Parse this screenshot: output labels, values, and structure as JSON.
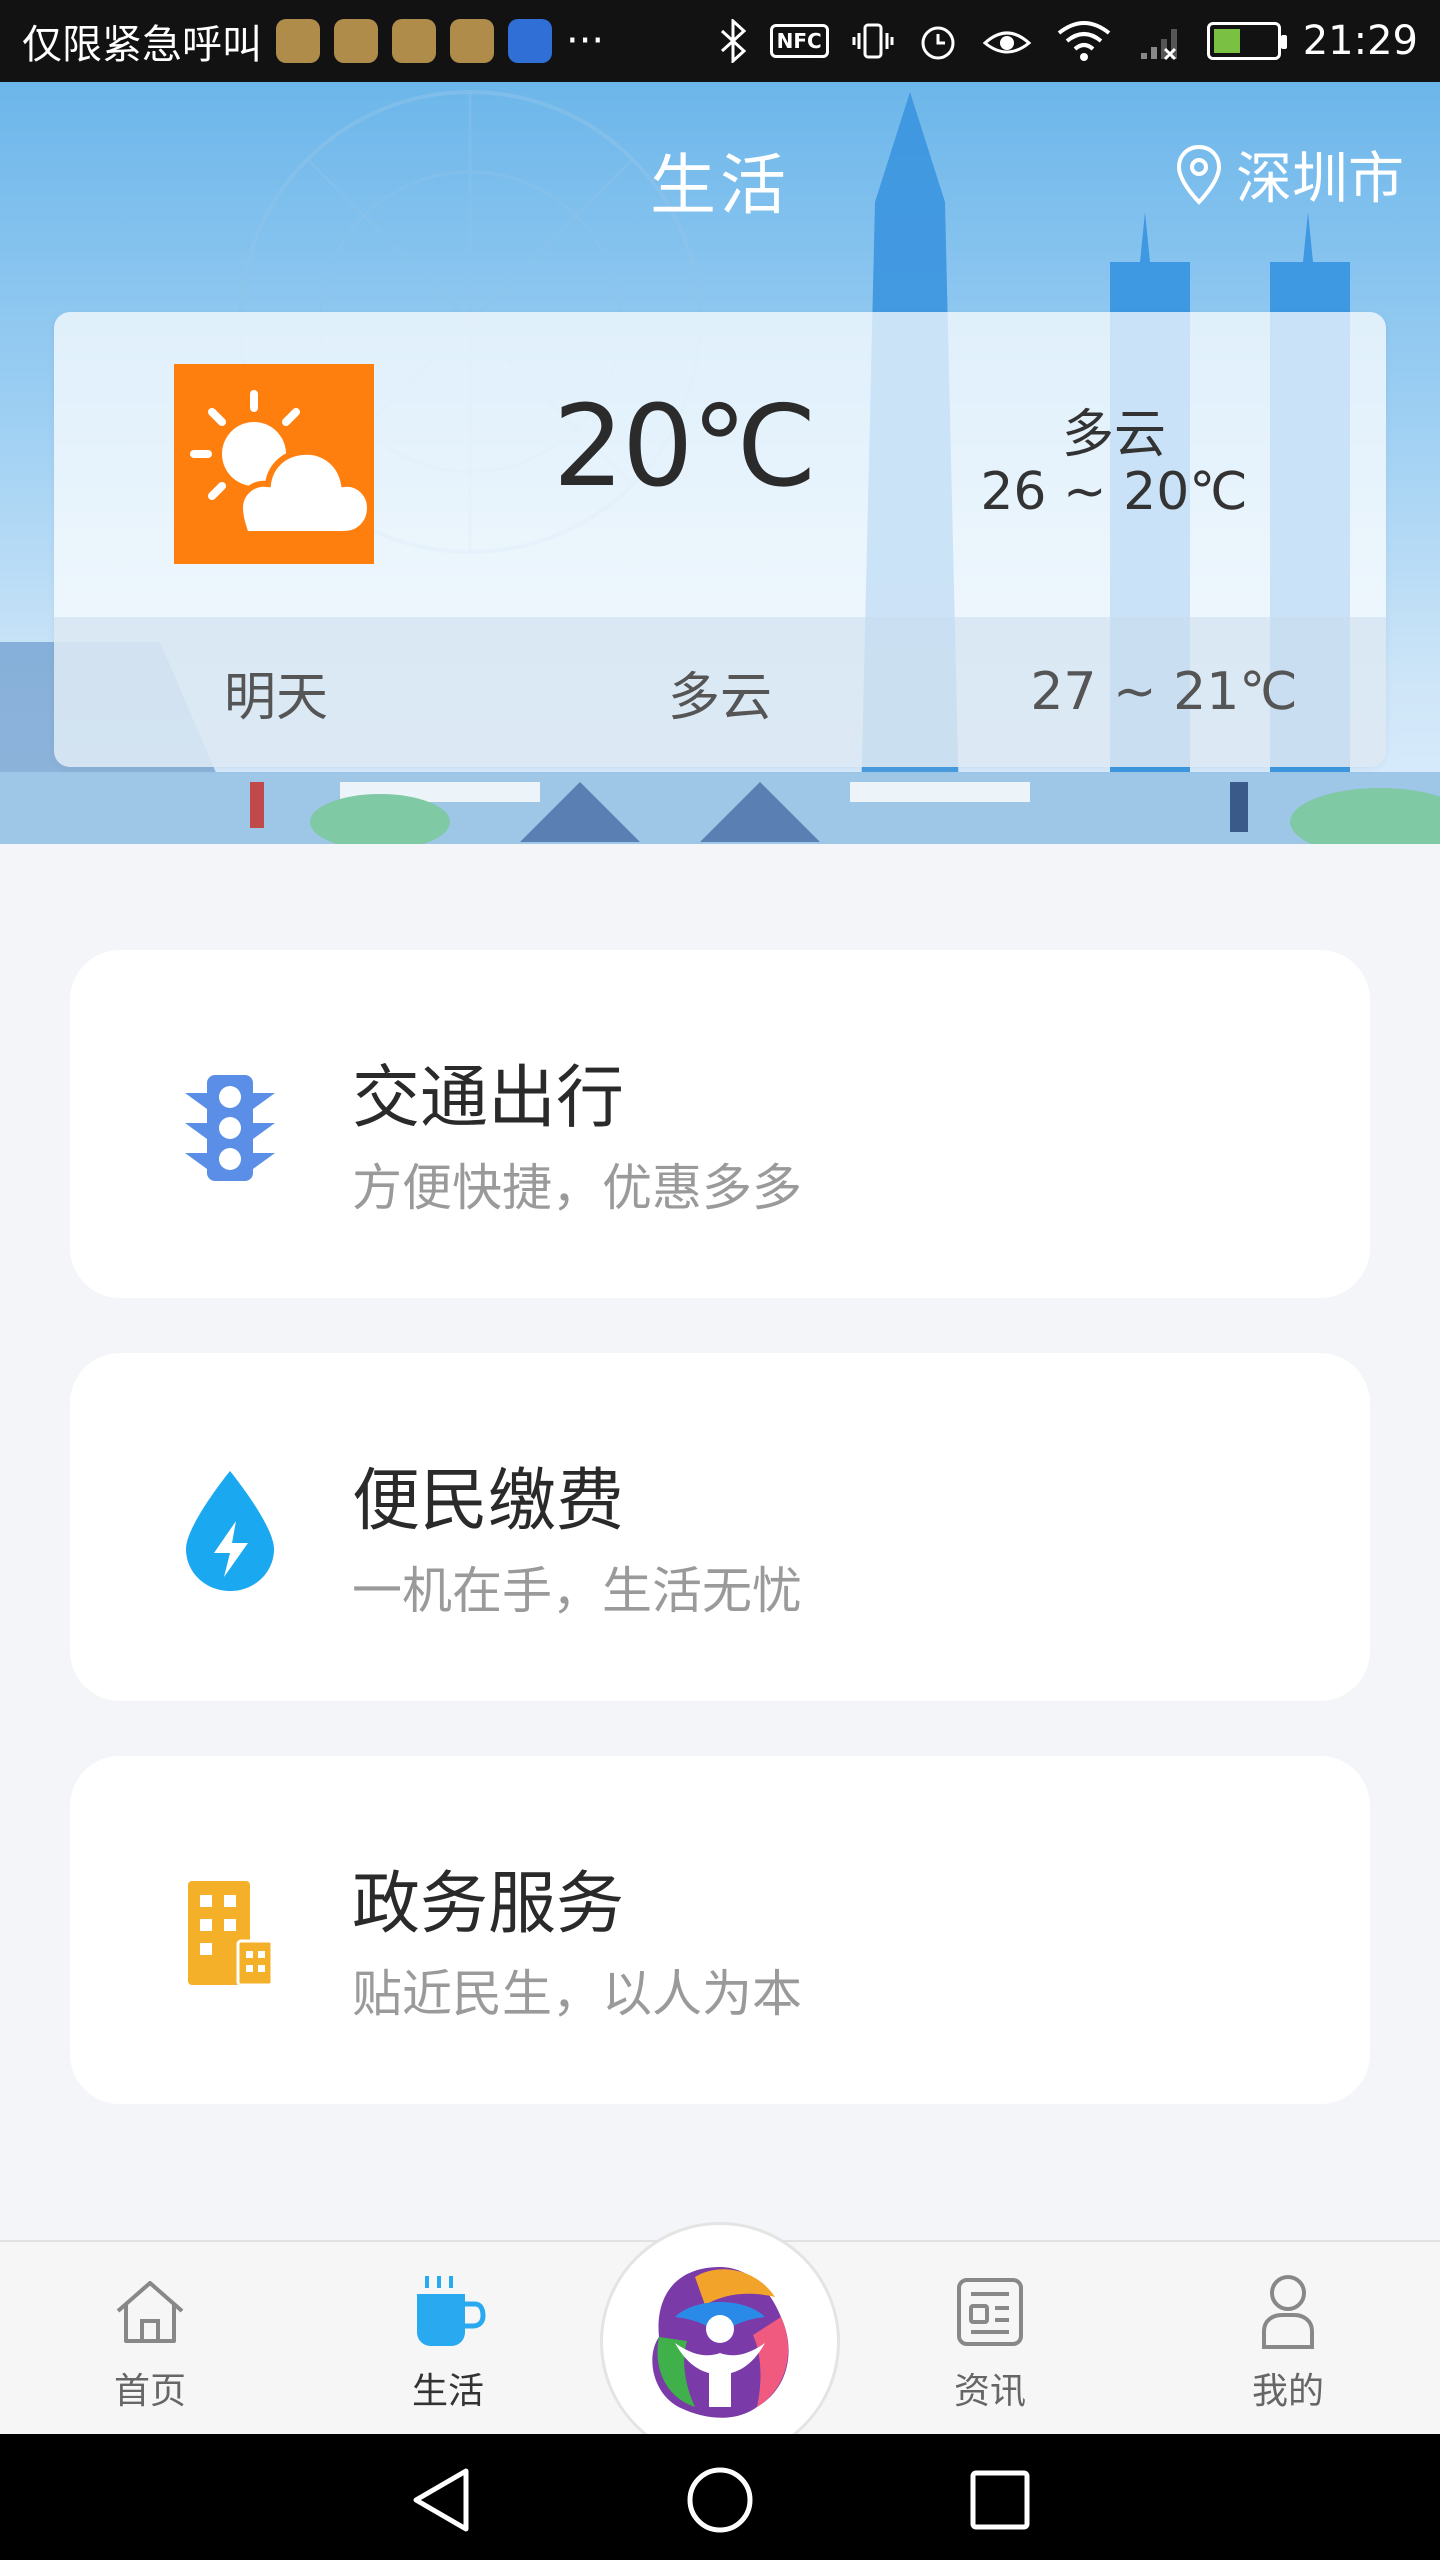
{
  "status_bar": {
    "carrier_text": "仅限紧急呼叫",
    "more": "···",
    "nfc": "NFC",
    "time": "21:29"
  },
  "header": {
    "title": "生活",
    "city": "深圳市"
  },
  "weather": {
    "current_temp": "20℃",
    "today_desc": "多云",
    "today_range": "26 ~ 20℃",
    "tomorrow_label": "明天",
    "tomorrow_desc": "多云",
    "tomorrow_range": "27 ~ 21℃",
    "icon": "partly-cloudy-icon",
    "icon_color": "#ff7f0e"
  },
  "services": [
    {
      "title": "交通出行",
      "subtitle": "方便快捷，优惠多多",
      "icon": "traffic-light-icon",
      "color": "#5b8ee6"
    },
    {
      "title": "便民缴费",
      "subtitle": "一机在手，生活无忧",
      "icon": "water-drop-icon",
      "color": "#1aa8f0"
    },
    {
      "title": "政务服务",
      "subtitle": "贴近民生，以人为本",
      "icon": "building-icon",
      "color": "#f5b02a"
    }
  ],
  "tab_bar": {
    "tabs": [
      {
        "label": "首页",
        "icon": "home-icon",
        "active": false
      },
      {
        "label": "生活",
        "icon": "cup-icon",
        "active": true
      },
      {
        "label": "资讯",
        "icon": "news-icon",
        "active": false
      },
      {
        "label": "我的",
        "icon": "person-icon",
        "active": false
      }
    ],
    "active_color": "#29a9f0"
  }
}
